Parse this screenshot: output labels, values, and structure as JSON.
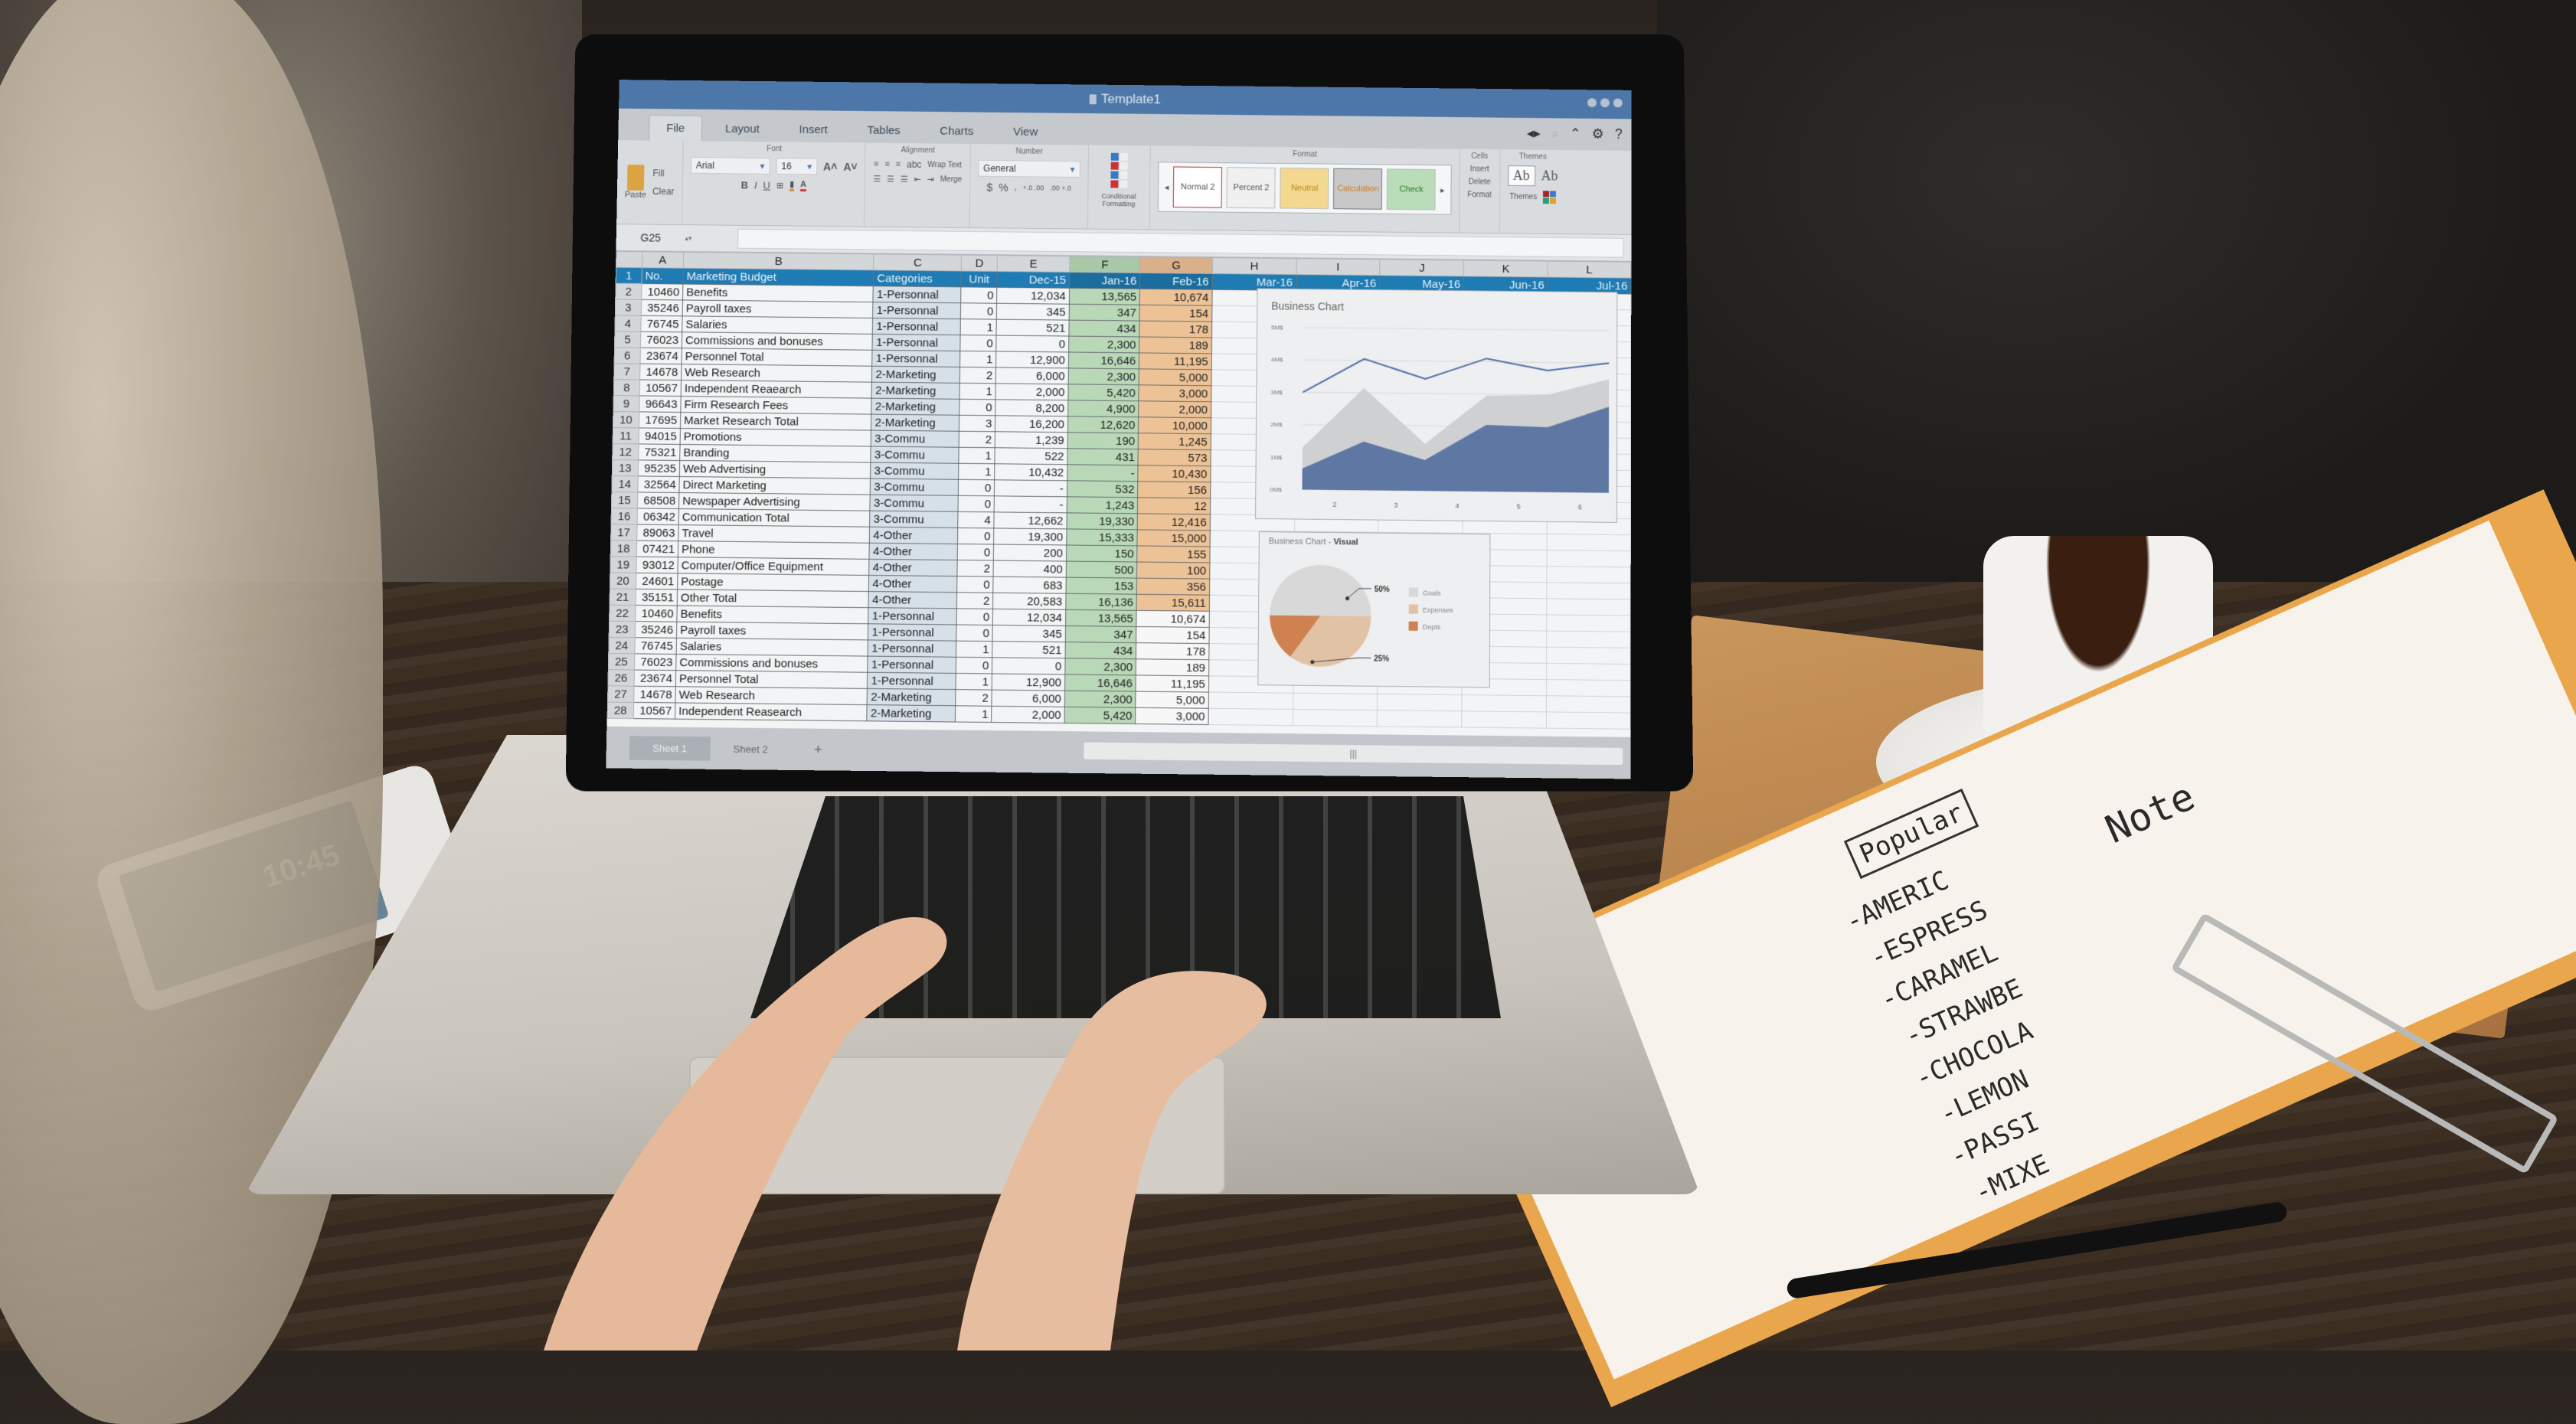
{
  "window": {
    "title": "Template1",
    "doc_icon": "document-icon"
  },
  "menu_tabs": [
    "File",
    "Layout",
    "Insert",
    "Tables",
    "Charts",
    "View"
  ],
  "active_tab": "File",
  "ribbon": {
    "clipboard": {
      "paste": "Paste",
      "fill": "Fill",
      "clear": "Clear"
    },
    "font": {
      "group": "Font",
      "family": "Arial",
      "size": "16",
      "bold": "B",
      "italic": "I",
      "underline": "U"
    },
    "alignment": {
      "group": "Alignment",
      "orientation": "abc",
      "wrap_text": "Wrap Text",
      "merge": "Merge"
    },
    "number": {
      "group": "Number",
      "format": "General",
      "currency": "$",
      "percent": "%",
      "comma": ",",
      "increase_decimal": "+.0 .00",
      "decrease_decimal": ".00 +.0"
    },
    "conditional_formatting": "Conditional Formatting",
    "format": {
      "group": "Format",
      "styles": [
        "Normal 2",
        "Percent 2",
        "Neutral",
        "Calculation",
        "Check"
      ]
    },
    "cells": {
      "group": "Cells",
      "insert": "Insert",
      "delete": "Delete",
      "format": "Format"
    },
    "themes": {
      "group": "Themes",
      "themes_label": "Themes",
      "font_sample": "Ab"
    }
  },
  "formula_bar": {
    "name_box": "G25",
    "value": ""
  },
  "columns": [
    "A",
    "B",
    "C",
    "D",
    "E",
    "F",
    "G",
    "H",
    "I",
    "J",
    "K",
    "L"
  ],
  "header_row": [
    "No.",
    "Marketing Budget",
    "Categories",
    "Unit",
    "Dec-15",
    "Jan-16",
    "Feb-16",
    "Mar-16",
    "Apr-16",
    "May-16",
    "Jun-16",
    "Jul-16"
  ],
  "rows": [
    {
      "n": "2",
      "no": "10460",
      "item": "Benefits",
      "cat": "1-Personnal",
      "unit": "0",
      "dec": "12,034",
      "jan": "13,565",
      "feb": "10,674"
    },
    {
      "n": "3",
      "no": "35246",
      "item": "Payroll taxes",
      "cat": "1-Personnal",
      "unit": "0",
      "dec": "345",
      "jan": "347",
      "feb": "154"
    },
    {
      "n": "4",
      "no": "76745",
      "item": "Salaries",
      "cat": "1-Personnal",
      "unit": "1",
      "dec": "521",
      "jan": "434",
      "feb": "178"
    },
    {
      "n": "5",
      "no": "76023",
      "item": "Commissions and bonuses",
      "cat": "1-Personnal",
      "unit": "0",
      "dec": "0",
      "jan": "2,300",
      "feb": "189"
    },
    {
      "n": "6",
      "no": "23674",
      "item": "Personnel Total",
      "cat": "1-Personnal",
      "unit": "1",
      "dec": "12,900",
      "jan": "16,646",
      "feb": "11,195"
    },
    {
      "n": "7",
      "no": "14678",
      "item": "Web Research",
      "cat": "2-Marketing",
      "unit": "2",
      "dec": "6,000",
      "jan": "2,300",
      "feb": "5,000"
    },
    {
      "n": "8",
      "no": "10567",
      "item": "Independent Reaearch",
      "cat": "2-Marketing",
      "unit": "1",
      "dec": "2,000",
      "jan": "5,420",
      "feb": "3,000"
    },
    {
      "n": "9",
      "no": "96643",
      "item": "Firm Research Fees",
      "cat": "2-Marketing",
      "unit": "0",
      "dec": "8,200",
      "jan": "4,900",
      "feb": "2,000"
    },
    {
      "n": "10",
      "no": "17695",
      "item": "Market Research Total",
      "cat": "2-Marketing",
      "unit": "3",
      "dec": "16,200",
      "jan": "12,620",
      "feb": "10,000"
    },
    {
      "n": "11",
      "no": "94015",
      "item": "Promotions",
      "cat": "3-Commu",
      "unit": "2",
      "dec": "1,239",
      "jan": "190",
      "feb": "1,245"
    },
    {
      "n": "12",
      "no": "75321",
      "item": "Branding",
      "cat": "3-Commu",
      "unit": "1",
      "dec": "522",
      "jan": "431",
      "feb": "573"
    },
    {
      "n": "13",
      "no": "95235",
      "item": "Web Advertising",
      "cat": "3-Commu",
      "unit": "1",
      "dec": "10,432",
      "jan": "-",
      "feb": "10,430"
    },
    {
      "n": "14",
      "no": "32564",
      "item": "Direct Marketing",
      "cat": "3-Commu",
      "unit": "0",
      "dec": "-",
      "jan": "532",
      "feb": "156"
    },
    {
      "n": "15",
      "no": "68508",
      "item": "Newspaper Advertising",
      "cat": "3-Commu",
      "unit": "0",
      "dec": "-",
      "jan": "1,243",
      "feb": "12"
    },
    {
      "n": "16",
      "no": "06342",
      "item": "Communication Total",
      "cat": "3-Commu",
      "unit": "4",
      "dec": "12,662",
      "jan": "19,330",
      "feb": "12,416"
    },
    {
      "n": "17",
      "no": "89063",
      "item": "Travel",
      "cat": "4-Other",
      "unit": "0",
      "dec": "19,300",
      "jan": "15,333",
      "feb": "15,000"
    },
    {
      "n": "18",
      "no": "07421",
      "item": "Phone",
      "cat": "4-Other",
      "unit": "0",
      "dec": "200",
      "jan": "150",
      "feb": "155"
    },
    {
      "n": "19",
      "no": "93012",
      "item": "Computer/Office Equipment",
      "cat": "4-Other",
      "unit": "2",
      "dec": "400",
      "jan": "500",
      "feb": "100"
    },
    {
      "n": "20",
      "no": "24601",
      "item": "Postage",
      "cat": "4-Other",
      "unit": "0",
      "dec": "683",
      "jan": "153",
      "feb": "356"
    },
    {
      "n": "21",
      "no": "35151",
      "item": "Other Total",
      "cat": "4-Other",
      "unit": "2",
      "dec": "20,583",
      "jan": "16,136",
      "feb": "15,611"
    },
    {
      "n": "22",
      "no": "10460",
      "item": "Benefits",
      "cat": "1-Personnal",
      "unit": "0",
      "dec": "12,034",
      "jan": "13,565",
      "feb": "10,674"
    },
    {
      "n": "23",
      "no": "35246",
      "item": "Payroll taxes",
      "cat": "1-Personnal",
      "unit": "0",
      "dec": "345",
      "jan": "347",
      "feb": "154"
    },
    {
      "n": "24",
      "no": "76745",
      "item": "Salaries",
      "cat": "1-Personnal",
      "unit": "1",
      "dec": "521",
      "jan": "434",
      "feb": "178"
    },
    {
      "n": "25",
      "no": "76023",
      "item": "Commissions and bonuses",
      "cat": "1-Personnal",
      "unit": "0",
      "dec": "0",
      "jan": "2,300",
      "feb": "189"
    },
    {
      "n": "26",
      "no": "23674",
      "item": "Personnel Total",
      "cat": "1-Personnal",
      "unit": "1",
      "dec": "12,900",
      "jan": "16,646",
      "feb": "11,195"
    },
    {
      "n": "27",
      "no": "14678",
      "item": "Web Research",
      "cat": "2-Marketing",
      "unit": "2",
      "dec": "6,000",
      "jan": "2,300",
      "feb": "5,000"
    },
    {
      "n": "28",
      "no": "10567",
      "item": "Independent Reasearch",
      "cat": "2-Marketing",
      "unit": "1",
      "dec": "2,000",
      "jan": "5,420",
      "feb": "3,000"
    }
  ],
  "line_chart": {
    "title": "Business Chart",
    "y_ticks": [
      "0M$",
      "1M$",
      "2M$",
      "3M$",
      "4M$",
      "5M$"
    ],
    "x_ticks": [
      "2",
      "3",
      "4",
      "5",
      "6"
    ],
    "ylim": [
      0,
      5
    ],
    "line_series": [
      3.0,
      4.05,
      3.45,
      4.1,
      3.75,
      4.0
    ],
    "area_light": [
      1.3,
      3.15,
      1.45,
      2.95,
      3.0,
      3.5
    ],
    "area_dark": [
      0.65,
      1.5,
      0.95,
      2.05,
      2.0,
      2.65
    ]
  },
  "pie_chart": {
    "title": "Business Chart - ",
    "title_bold": "Visual",
    "slices": [
      {
        "label": "Goals",
        "value": 50,
        "color": "#d8d8d8"
      },
      {
        "label": "Expenses",
        "value": 35,
        "color": "#e2c2a4"
      },
      {
        "label": "Depts",
        "value": 15,
        "color": "#cf8150"
      }
    ],
    "callouts": [
      "50%",
      "25%"
    ]
  },
  "sheet_tabs": [
    "Sheet 1",
    "Sheet 2"
  ],
  "add_sheet": "+",
  "scroll_grip": "|||",
  "phone": {
    "time": "10:45"
  },
  "notes": {
    "header": "Popular",
    "items": [
      "-AMERIC",
      "-ESPRESS",
      "-CARAMEL",
      "-STRAWBE",
      "-CHOCOLA",
      "-LEMON",
      "-PASSI",
      "-MIXE"
    ],
    "title2": "Note"
  },
  "colors": {
    "titlebar": "#4d77a8",
    "header_blue": "#1f7bb3",
    "col_f_green": "#b8d8b8",
    "col_g_orange": "#ecc296",
    "category_blue": "#d6e0e9"
  }
}
